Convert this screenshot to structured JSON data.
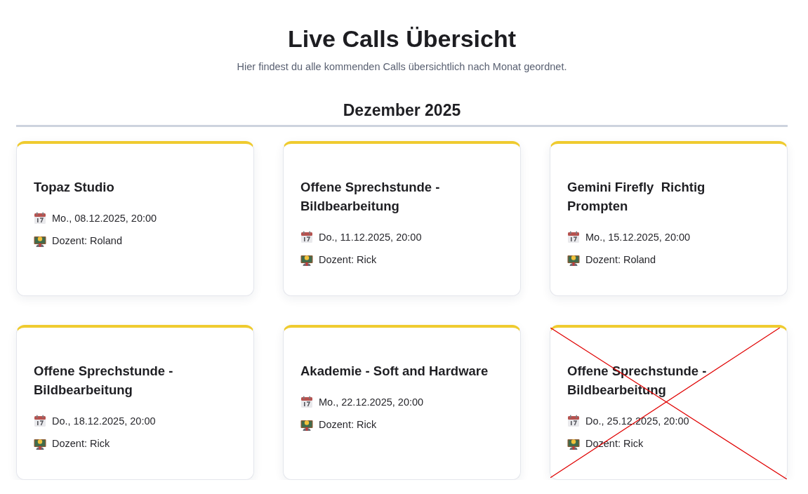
{
  "page": {
    "title": "Live Calls Übersicht",
    "subtitle": "Hier findest du alle kommenden Calls übersichtlich nach Monat geordnet."
  },
  "months": [
    {
      "heading": "Dezember 2025",
      "events": [
        {
          "title": "Topaz Studio",
          "date": "Mo., 08.12.2025, 20:00",
          "lecturer": "Dozent: Roland",
          "cancelled": false
        },
        {
          "title": "Offene Sprechstunde - Bildbearbeitung",
          "date": "Do., 11.12.2025, 20:00",
          "lecturer": "Dozent: Rick",
          "cancelled": false
        },
        {
          "title": "Gemini Firefly  Richtig Prompten",
          "date": "Mo., 15.12.2025, 20:00",
          "lecturer": "Dozent: Roland",
          "cancelled": false
        },
        {
          "title": "Offene Sprechstunde - Bildbearbeitung",
          "date": "Do., 18.12.2025, 20:00",
          "lecturer": "Dozent: Rick",
          "cancelled": false
        },
        {
          "title": "Akademie - Soft and Hardware",
          "date": "Mo., 22.12.2025, 20:00",
          "lecturer": "Dozent: Rick",
          "cancelled": false
        },
        {
          "title": "Offene Sprechstunde - Bildbearbeitung",
          "date": "Do., 25.12.2025, 20:00",
          "lecturer": "Dozent: Rick",
          "cancelled": true
        }
      ]
    }
  ]
}
